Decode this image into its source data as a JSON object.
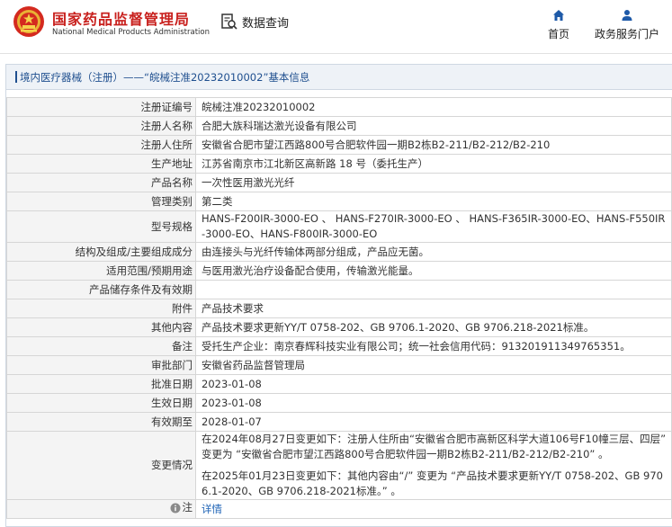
{
  "header": {
    "brand_cn": "国家药品监督管理局",
    "brand_en": "National Medical Products Administration",
    "query_label": "数据查询",
    "nav": [
      {
        "label": "首页",
        "icon": "home-icon"
      },
      {
        "label": "政务服务门户",
        "icon": "user-icon"
      }
    ]
  },
  "colors": {
    "brand_red": "#c8201d",
    "link_blue": "#1e63b6",
    "label_bg": "#f4f4f4",
    "panel_head_bg": "#eef2f7"
  },
  "panel": {
    "title": "境内医疗器械（注册）——“皖械注准20232010002”基本信息"
  },
  "rows": [
    {
      "label": "注册证编号",
      "value": "皖械注准20232010002"
    },
    {
      "label": "注册人名称",
      "value": "合肥大族科瑞达激光设备有限公司"
    },
    {
      "label": "注册人住所",
      "value": "安徽省合肥市望江西路800号合肥软件园一期B2栋B2-211/B2-212/B2-210"
    },
    {
      "label": "生产地址",
      "value": "江苏省南京市江北新区高新路 18 号（委托生产）"
    },
    {
      "label": "产品名称",
      "value": "一次性医用激光光纤"
    },
    {
      "label": "管理类别",
      "value": "第二类"
    },
    {
      "label": "型号规格",
      "value": "HANS-F200IR-3000-EO 、 HANS-F270IR-3000-EO 、 HANS-F365IR-3000-EO、HANS-F550IR-3000-EO、HANS-F800IR-3000-EO"
    },
    {
      "label": "结构及组成/主要组成成分",
      "value": "由连接头与光纤传输体两部分组成，产品应无菌。"
    },
    {
      "label": "适用范围/预期用途",
      "value": "与医用激光治疗设备配合使用，传输激光能量。"
    },
    {
      "label": "产品储存条件及有效期",
      "value": ""
    },
    {
      "label": "附件",
      "value": "产品技术要求"
    },
    {
      "label": "其他内容",
      "value": "产品技术要求更新YY/T 0758-202、GB 9706.1-2020、GB 9706.218-2021标准。"
    },
    {
      "label": "备注",
      "value": "受托生产企业：南京春辉科技实业有限公司；统一社会信用代码：913201911349765351。"
    },
    {
      "label": "审批部门",
      "value": "安徽省药品监督管理局"
    },
    {
      "label": "批准日期",
      "value": "2023-01-08"
    },
    {
      "label": "生效日期",
      "value": "2023-01-08"
    },
    {
      "label": "有效期至",
      "value": "2028-01-07"
    }
  ],
  "change": {
    "label": "变更情况",
    "entries": [
      "在2024年08月27日变更如下：注册人住所由“安徽省合肥市高新区科学大道106号F10幢三层、四层” 变更为 “安徽省合肥市望江西路800号合肥软件园一期B2栋B2-211/B2-212/B2-210” 。",
      "在2025年01月23日变更如下：其他内容由“/” 变更为 “产品技术要求更新YY/T 0758-202、GB 9706.1-2020、GB 9706.218-2021标准。” 。"
    ]
  },
  "note": {
    "label": "注",
    "link_text": "详情"
  }
}
